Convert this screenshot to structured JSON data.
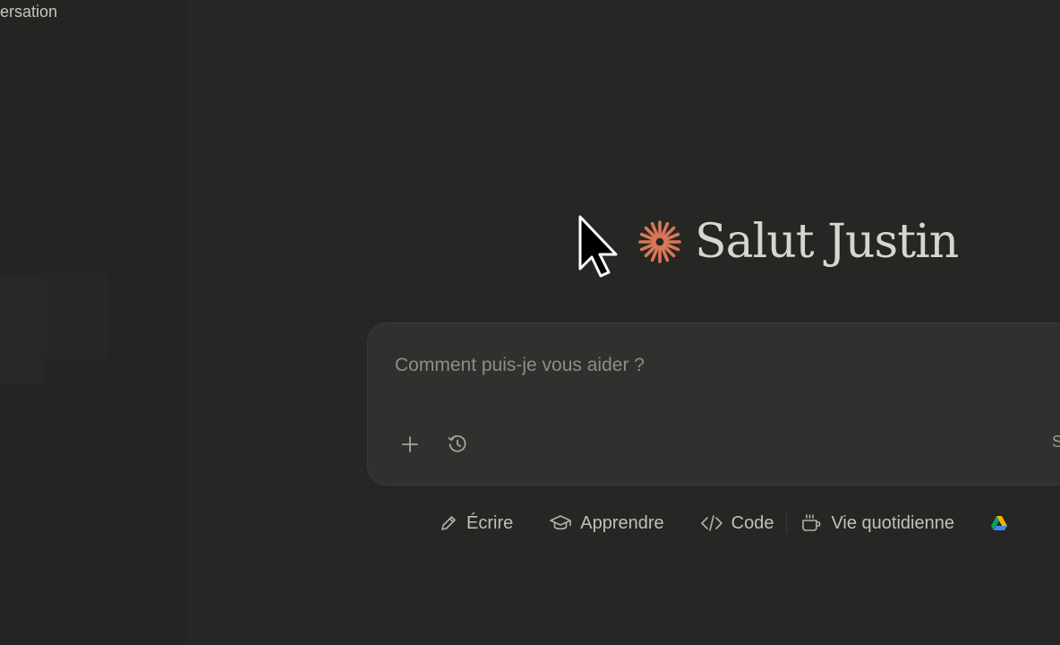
{
  "sidebar": {
    "partial_link": "ersation"
  },
  "greeting": {
    "text": "Salut Justin",
    "logo_icon": "sparkle-burst-icon",
    "logo_color": "#d97757"
  },
  "composer": {
    "placeholder": "Comment puis-je vous aider ?",
    "value": "",
    "add_icon": "plus-icon",
    "history_icon": "clock-icon",
    "trailing_text": "S"
  },
  "chips": [
    {
      "label": "Écrire",
      "icon": "pencil-icon"
    },
    {
      "label": "Apprendre",
      "icon": "graduation-cap-icon"
    },
    {
      "label": "Code",
      "icon": "code-icon"
    },
    {
      "label": "Vie quotidienne",
      "icon": "coffee-cup-icon"
    }
  ],
  "drive_icon": "google-drive-icon",
  "colors": {
    "background": "#262624",
    "composer": "#30302e",
    "accent": "#d97757",
    "text": "#c2c0b6"
  }
}
